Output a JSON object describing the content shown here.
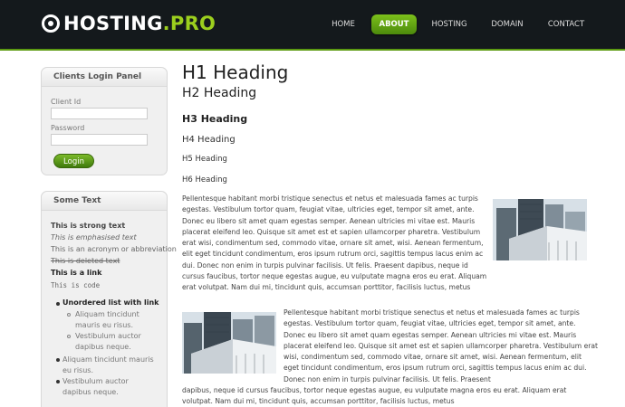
{
  "logo": {
    "main": "HOSTING",
    "dot": ".",
    "accent": "PRO"
  },
  "nav": [
    "HOME",
    "ABOUT",
    "HOSTING",
    "DOMAIN",
    "CONTACT"
  ],
  "login": {
    "title": "Clients Login Panel",
    "client_label": "Client Id",
    "password_label": "Password",
    "button": "Login"
  },
  "sometext": {
    "title": "Some Text",
    "strong": "This is strong text",
    "em": "This is emphasised text",
    "acronym": "This is an acronym or abbreviation",
    "deleted": "This is deleted text",
    "link": "This is a link",
    "code": "This is code",
    "list_title": "Unordered list with link",
    "sub1": "Aliquam tincidunt mauris eu risus.",
    "sub2": "Vestibulum auctor dapibus neque.",
    "item2": "Aliquam tincidunt mauris eu risus.",
    "item3": "Vestibulum auctor dapibus neque."
  },
  "headings": {
    "h1": "H1 Heading",
    "h2": "H2 Heading",
    "h3": "H3 Heading",
    "h4": "H4 Heading",
    "h5": "H5 Heading",
    "h6": "H6 Heading"
  },
  "para1": "Pellentesque habitant morbi tristique senectus et netus et malesuada fames ac turpis egestas. Vestibulum tortor quam, feugiat vitae, ultricies eget, tempor sit amet, ante. Donec eu libero sit amet quam egestas semper. Aenean ultricies mi vitae est. Mauris placerat eleifend leo. Quisque sit amet est et sapien ullamcorper pharetra. Vestibulum erat wisi, condimentum sed, commodo vitae, ornare sit amet, wisi. Aenean fermentum, elit eget tincidunt condimentum, eros ipsum rutrum orci, sagittis tempus lacus enim ac dui. Donec non enim in turpis pulvinar facilisis. Ut felis. Praesent dapibus, neque id cursus faucibus, tortor neque egestas augue, eu vulputate magna eros eu erat. Aliquam erat volutpat. Nam dui mi, tincidunt quis, accumsan porttitor, facilisis luctus, metus",
  "para2a": "Pellentesque habitant morbi tristique senectus et netus et malesuada fames ac turpis egestas. Vestibulum tortor quam, feugiat vitae, ultricies eget, tempor sit amet, ante. Donec eu libero sit amet quam egestas semper. Aenean ultricies mi vitae est. Mauris placerat eleifend leo. Quisque sit amet est et sapien ullamcorper pharetra. Vestibulum erat wisi, condimentum sed, commodo vitae, ornare sit amet, wisi. Aenean fermentum, elit eget tincidunt condimentum, eros ipsum rutrum orci, sagittis tempus lacus enim ac dui. Donec non enim in turpis pulvinar facilisis. Ut felis. Praesent",
  "para2b": "dapibus, neque id cursus faucibus, tortor neque egestas augue, eu vulputate magna eros eu erat. Aliquam erat volutpat. Nam dui mi, tincidunt quis, accumsan porttitor, facilisis luctus, metus",
  "colors": {
    "header_bg": "#14191c",
    "accent_green": "#9ccf1e",
    "active_nav": "#5c9a12"
  }
}
